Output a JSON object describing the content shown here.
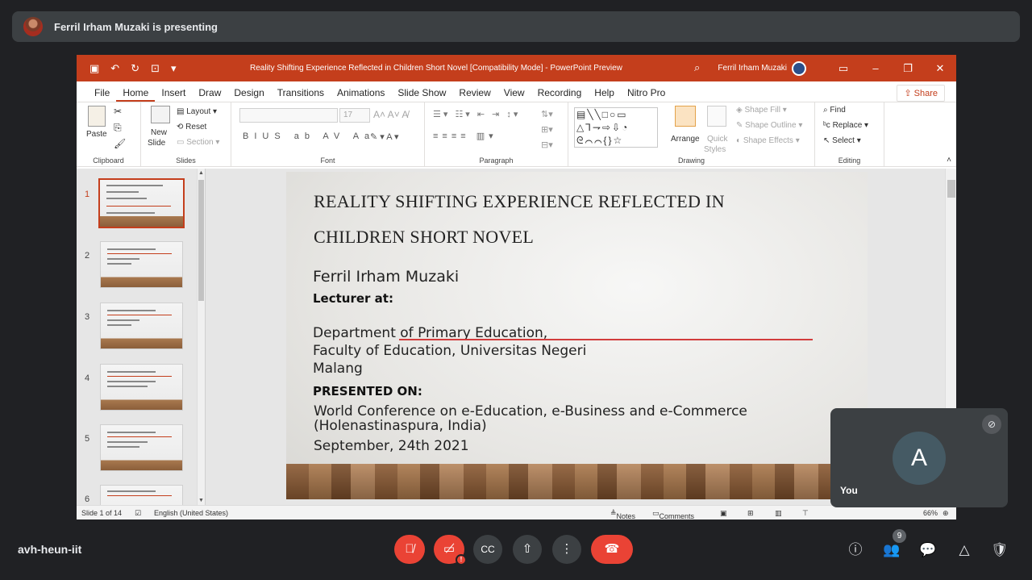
{
  "presenter": {
    "name": "Ferril Irham Muzaki is presenting"
  },
  "powerpoint": {
    "window_title": "Reality Shifting Experience Reflected in Children Short Novel [Compatibility Mode]  -  PowerPoint Preview",
    "user_name": "Ferril Irham Muzaki",
    "menu_tabs": [
      "File",
      "Home",
      "Insert",
      "Draw",
      "Design",
      "Transitions",
      "Animations",
      "Slide Show",
      "Review",
      "View",
      "Recording",
      "Help",
      "Nitro Pro"
    ],
    "share_label": "Share",
    "ribbon": {
      "paste": "Paste",
      "layout": "Layout",
      "reset": "Reset",
      "section": "Section",
      "new_slide_1": "New",
      "new_slide_2": "Slide",
      "font_size": "17",
      "arrange": "Arrange",
      "quick_styles_1": "Quick",
      "quick_styles_2": "Styles",
      "shape_fill": "Shape Fill",
      "shape_outline": "Shape Outline",
      "shape_effects": "Shape Effects",
      "find": "Find",
      "replace": "Replace",
      "select": "Select",
      "groups": {
        "clipboard": "Clipboard",
        "slides": "Slides",
        "font": "Font",
        "paragraph": "Paragraph",
        "drawing": "Drawing",
        "editing": "Editing"
      }
    },
    "thumbnails": [
      "1",
      "2",
      "3",
      "4",
      "5",
      "6"
    ],
    "slide": {
      "title_line1": "REALITY SHIFTING EXPERIENCE REFLECTED IN",
      "title_line2": "CHILDREN SHORT NOVEL",
      "author": "Ferril Irham Muzaki",
      "lecturer_label": "Lecturer at:",
      "dept_line1": "Department of Primary Education,",
      "dept_line2": "Faculty of Education, Universitas Negeri",
      "dept_line3": "Malang",
      "presented_label": "PRESENTED ON:",
      "conf_line1": "World Conference on e-Education, e-Business and e-Commerce",
      "conf_line2": "(Holenastinaspura, India)",
      "date": "September, 24th 2021"
    },
    "status": {
      "slide_count": "Slide 1 of 14",
      "language": "English (United States)",
      "notes": "Notes",
      "comments": "Comments",
      "zoom": "66%"
    }
  },
  "self_tile": {
    "initial": "A",
    "label": "You"
  },
  "meeting": {
    "code": "avh-heun-iit",
    "participant_count": "9"
  }
}
